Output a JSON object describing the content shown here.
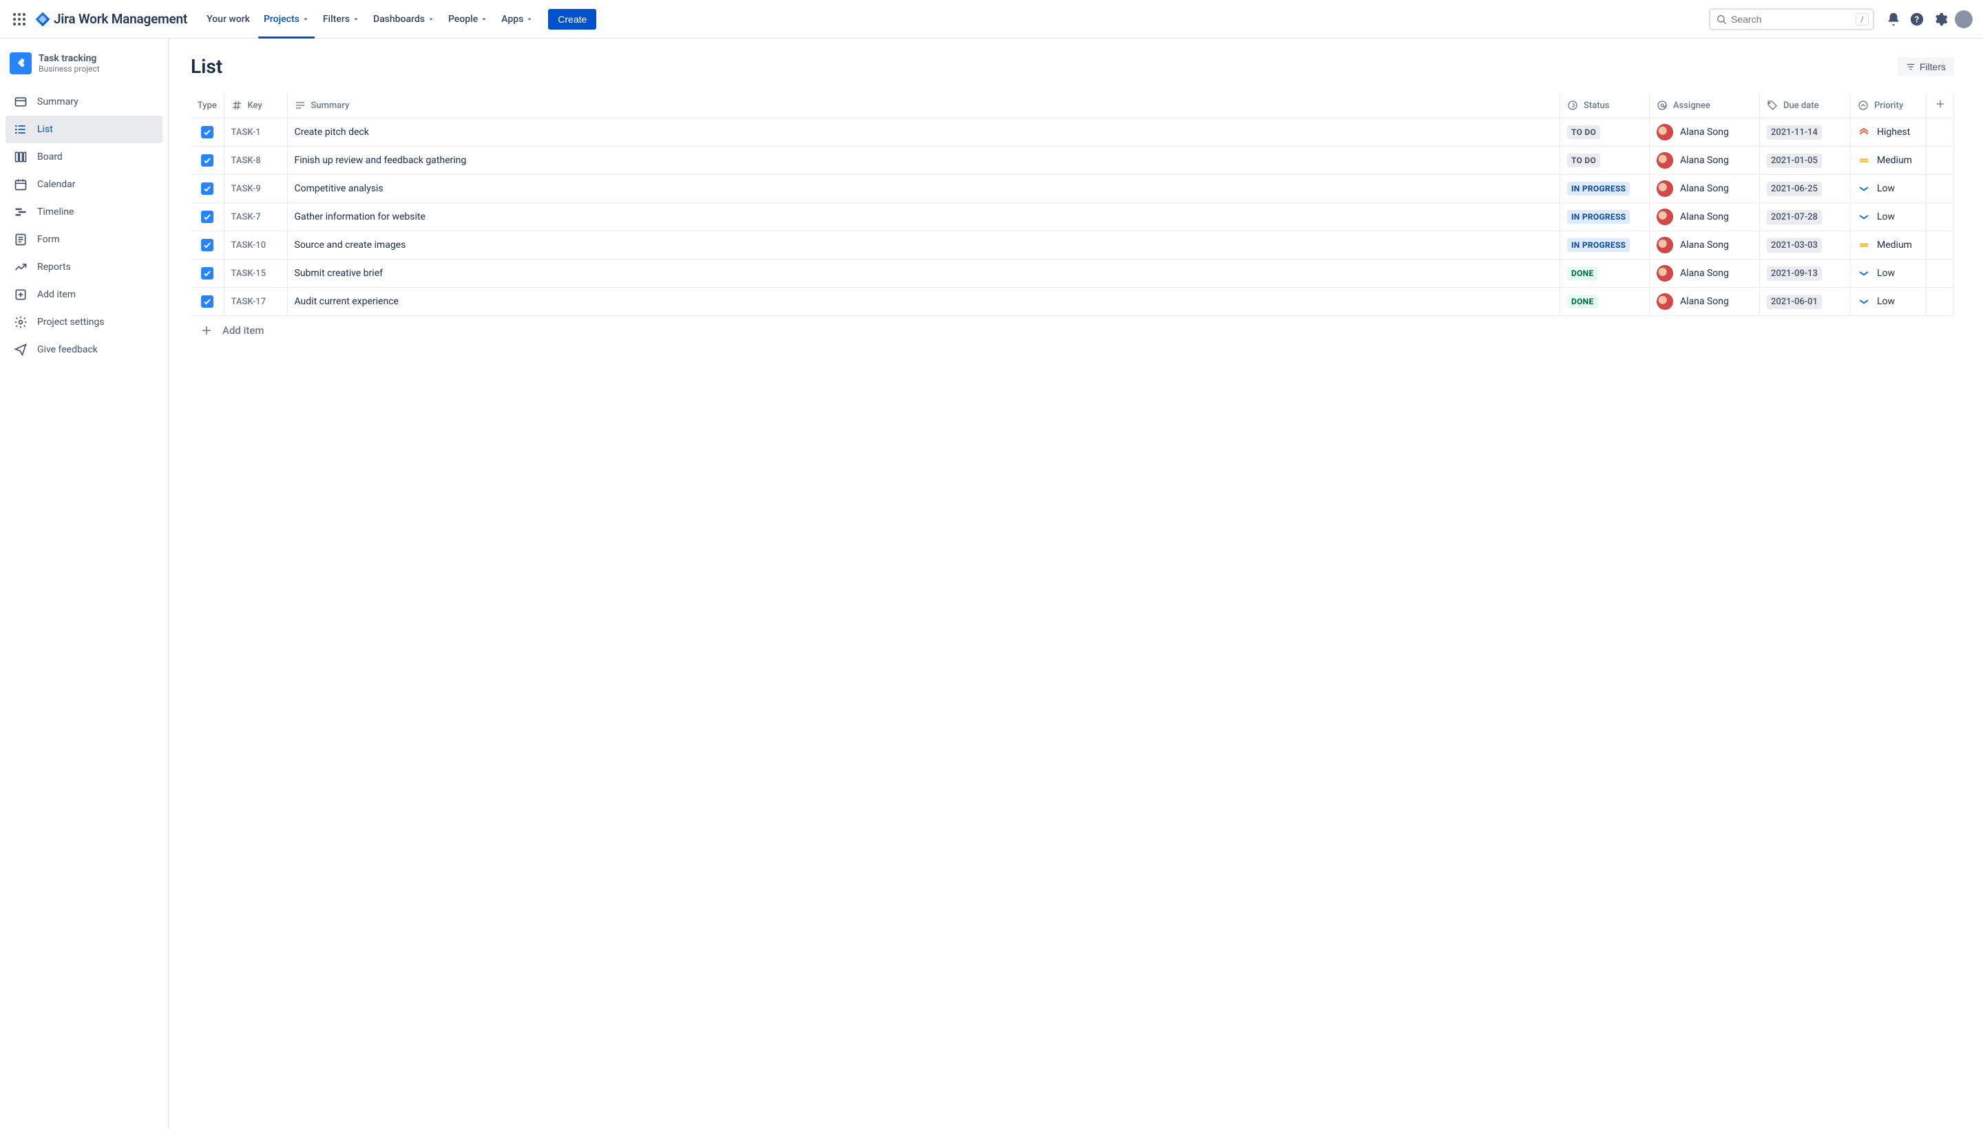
{
  "app": {
    "name": "Jira Work Management"
  },
  "topnav": {
    "items": [
      {
        "label": "Your work",
        "dropdown": false,
        "active": false
      },
      {
        "label": "Projects",
        "dropdown": true,
        "active": true
      },
      {
        "label": "Filters",
        "dropdown": true,
        "active": false
      },
      {
        "label": "Dashboards",
        "dropdown": true,
        "active": false
      },
      {
        "label": "People",
        "dropdown": true,
        "active": false
      },
      {
        "label": "Apps",
        "dropdown": true,
        "active": false
      }
    ],
    "create_label": "Create",
    "search_placeholder": "Search",
    "search_kbd": "/"
  },
  "sidebar": {
    "project_name": "Task tracking",
    "project_sub": "Business project",
    "items": [
      {
        "label": "Summary",
        "icon": "summary"
      },
      {
        "label": "List",
        "icon": "list",
        "selected": true
      },
      {
        "label": "Board",
        "icon": "board"
      },
      {
        "label": "Calendar",
        "icon": "calendar"
      },
      {
        "label": "Timeline",
        "icon": "timeline"
      },
      {
        "label": "Form",
        "icon": "form"
      },
      {
        "label": "Reports",
        "icon": "reports"
      },
      {
        "label": "Add item",
        "icon": "add"
      },
      {
        "label": "Project settings",
        "icon": "settings"
      },
      {
        "label": "Give feedback",
        "icon": "feedback"
      }
    ]
  },
  "main": {
    "title": "List",
    "filters_label": "Filters",
    "add_item_label": "Add item",
    "columns": {
      "type": "Type",
      "key": "Key",
      "summary": "Summary",
      "status": "Status",
      "assignee": "Assignee",
      "due": "Due date",
      "priority": "Priority"
    },
    "rows": [
      {
        "key": "TASK-1",
        "summary": "Create pitch deck",
        "status": "TO DO",
        "status_class": "todo",
        "assignee": "Alana Song",
        "due": "2021-11-14",
        "priority": "Highest",
        "prio_kind": "highest"
      },
      {
        "key": "TASK-8",
        "summary": "Finish up review and feedback gathering",
        "status": "TO DO",
        "status_class": "todo",
        "assignee": "Alana Song",
        "due": "2021-01-05",
        "priority": "Medium",
        "prio_kind": "medium"
      },
      {
        "key": "TASK-9",
        "summary": "Competitive analysis",
        "status": "IN PROGRESS",
        "status_class": "inprogress",
        "assignee": "Alana Song",
        "due": "2021-06-25",
        "priority": "Low",
        "prio_kind": "low"
      },
      {
        "key": "TASK-7",
        "summary": "Gather information for website",
        "status": "IN PROGRESS",
        "status_class": "inprogress",
        "assignee": "Alana Song",
        "due": "2021-07-28",
        "priority": "Low",
        "prio_kind": "low"
      },
      {
        "key": "TASK-10",
        "summary": "Source and create images",
        "status": "IN PROGRESS",
        "status_class": "inprogress",
        "assignee": "Alana Song",
        "due": "2021-03-03",
        "priority": "Medium",
        "prio_kind": "medium"
      },
      {
        "key": "TASK-15",
        "summary": "Submit creative brief",
        "status": "DONE",
        "status_class": "done",
        "assignee": "Alana Song",
        "due": "2021-09-13",
        "priority": "Low",
        "prio_kind": "low"
      },
      {
        "key": "TASK-17",
        "summary": "Audit current experience",
        "status": "DONE",
        "status_class": "done",
        "assignee": "Alana Song",
        "due": "2021-06-01",
        "priority": "Low",
        "prio_kind": "low"
      }
    ]
  }
}
